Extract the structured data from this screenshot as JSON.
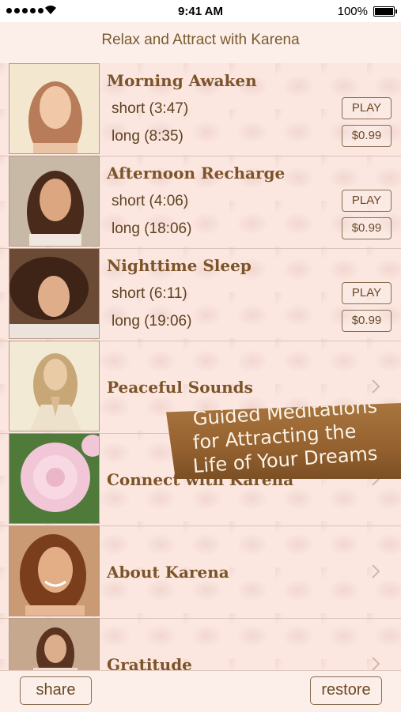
{
  "status_bar": {
    "time": "9:41 AM",
    "battery": "100%"
  },
  "nav": {
    "title": "Relax and Attract with Karena"
  },
  "rows": [
    {
      "title": "Morning Awaken",
      "tracks": [
        {
          "label": "short (3:47)",
          "button": "PLAY"
        },
        {
          "label": "long (8:35)",
          "button": "$0.99"
        }
      ]
    },
    {
      "title": "Afternoon Recharge",
      "tracks": [
        {
          "label": "short (4:06)",
          "button": "PLAY"
        },
        {
          "label": "long (18:06)",
          "button": "$0.99"
        }
      ]
    },
    {
      "title": "Nighttime Sleep",
      "tracks": [
        {
          "label": "short (6:11)",
          "button": "PLAY"
        },
        {
          "label": "long (19:06)",
          "button": "$0.99"
        }
      ]
    },
    {
      "title": "Peaceful Sounds"
    },
    {
      "title": "Connect with Karena"
    },
    {
      "title": "About Karena"
    },
    {
      "title": "Gratitude"
    }
  ],
  "banner": {
    "lines": [
      "Guided Meditations",
      "for Attracting the",
      "Life of Your Dreams"
    ]
  },
  "toolbar": {
    "share": "share",
    "restore": "restore"
  },
  "icons": {
    "disclosure": "chevron-right-icon"
  },
  "colors": {
    "title_brown": "#7c5429",
    "banner_brown": "#94612f",
    "background": "#fbe6e0"
  }
}
